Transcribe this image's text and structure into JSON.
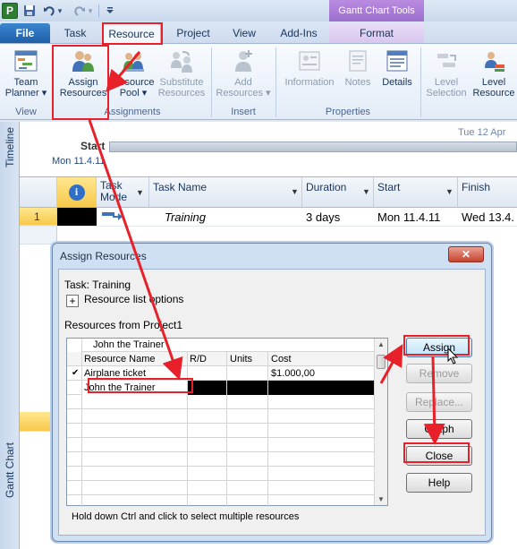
{
  "qat": {
    "app_logo": "P",
    "dropdown_glyph": "▾"
  },
  "contextual": {
    "gantt_tools": "Gantt Chart Tools"
  },
  "tabs": {
    "file": "File",
    "task": "Task",
    "resource": "Resource",
    "project": "Project",
    "view": "View",
    "addins": "Add-Ins",
    "format": "Format"
  },
  "ribbon": {
    "team_planner": [
      "Team",
      "Planner ▾"
    ],
    "assign_resources": [
      "Assign",
      "Resources"
    ],
    "resource_pool": [
      "Resource",
      "Pool ▾"
    ],
    "substitute_resources": [
      "Substitute",
      "Resources"
    ],
    "add_resources": [
      "Add",
      "Resources ▾"
    ],
    "information": "Information",
    "notes": "Notes",
    "details": "Details",
    "level_selection": [
      "Level",
      "Selection"
    ],
    "level_resource": [
      "Level",
      "Resource"
    ],
    "groups": {
      "view": "View",
      "assignments": "Assignments",
      "insert": "Insert",
      "properties": "Properties"
    }
  },
  "timeline": {
    "side_label": "Timeline",
    "date_right": "Tue 12 Apr",
    "start_label": "Start",
    "start_date": "Mon 11.4.11"
  },
  "gantt": {
    "side_label": "Gantt Chart",
    "headers": {
      "info": "i",
      "task_mode": "Task\nMode",
      "task_name": "Task Name",
      "duration": "Duration",
      "start": "Start",
      "finish": "Finish"
    },
    "rows": [
      {
        "id": "1",
        "name": "Training",
        "duration": "3 days",
        "start": "Mon 11.4.11",
        "finish": "Wed 13.4."
      }
    ]
  },
  "dialog": {
    "title": "Assign Resources",
    "close_glyph": "✕",
    "task_line": "Task: Training",
    "options_plus": "+",
    "resource_list_options": "Resource list options",
    "resources_from": "Resources from Project1",
    "edit_value": "John the Trainer",
    "columns": [
      "Resource Name",
      "R/D",
      "Units",
      "Cost"
    ],
    "resources": [
      {
        "check": "✔",
        "name": "Airplane ticket",
        "rd": "",
        "units": "",
        "cost": "$1.000,00"
      },
      {
        "check": "",
        "name": "John the Trainer",
        "rd": "",
        "units": "",
        "cost": ""
      }
    ],
    "buttons": {
      "assign": "Assign",
      "remove": "Remove",
      "replace": "Replace...",
      "graph": "Graph",
      "close": "Close",
      "help": "Help"
    },
    "footer": "Hold down Ctrl and click to select multiple resources"
  },
  "colors": {
    "accent": "#1f5fa8",
    "annotation": "#e8202a",
    "selection": "#000000"
  }
}
